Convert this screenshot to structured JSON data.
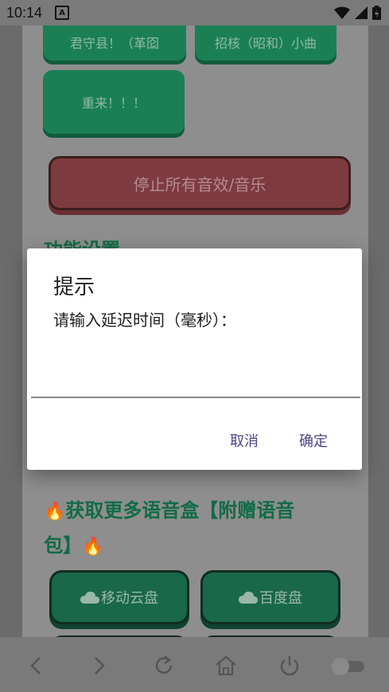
{
  "status_bar": {
    "time": "10:14",
    "notification_letter": "A"
  },
  "buttons_top": [
    {
      "label": "君守县！（革囵"
    },
    {
      "label": "招核（昭和）小曲"
    },
    {
      "label": "重来！！！"
    }
  ],
  "stop_button": {
    "label": "停止所有音效/音乐"
  },
  "section_settings": {
    "title": "功能设置"
  },
  "section_more": {
    "title_line1": "获取更多语音盒【附赠语音",
    "title_line2": "包】"
  },
  "cloud_buttons": [
    {
      "label": "移动云盘"
    },
    {
      "label": "百度盘"
    }
  ],
  "dialog": {
    "title": "提示",
    "message": "请输入延迟时间（毫秒）：",
    "input_value": "",
    "cancel_label": "取消",
    "ok_label": "确定"
  },
  "colors": {
    "green": "#1b7f56",
    "red": "#7e3b3f",
    "accent_text": "#4a4585"
  },
  "icons": {
    "back": "chevron-left-icon",
    "forward": "chevron-right-icon",
    "refresh": "refresh-icon",
    "home": "home-icon",
    "power": "power-icon",
    "toggle": "toggle-switch"
  }
}
